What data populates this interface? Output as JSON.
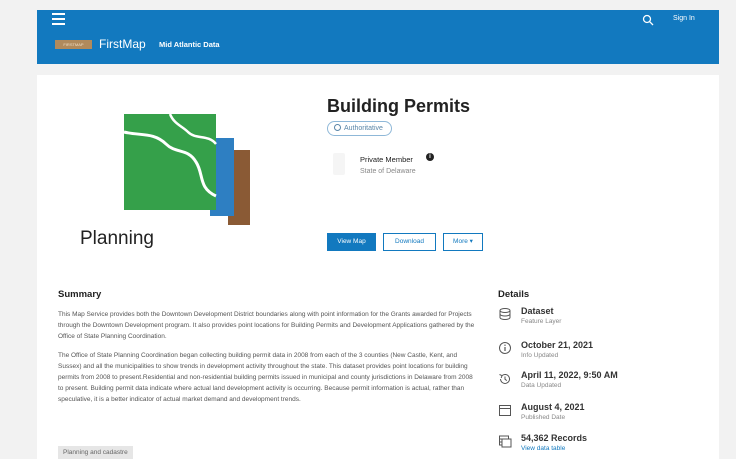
{
  "header": {
    "app_title": "FirstMap",
    "subtitle": "Mid Atlantic Data",
    "sign_in": "Sign In",
    "logo_text": "FIRSTMAP",
    "colors": {
      "bar": "#1279bf",
      "text": "#ffffff"
    }
  },
  "item": {
    "title": "Building Permits",
    "badge": "Authoritative",
    "thumbnail_caption": "Planning",
    "owner_name": "Private Member",
    "owner_org": "State of Delaware"
  },
  "actions": {
    "view_map": "View Map",
    "download": "Download",
    "more": "More ▾"
  },
  "summary": {
    "heading": "Summary",
    "paragraph1": "This Map Service provides both the Downtown Development District boundaries along with point information for the Grants awarded for Projects through the Downtown Development program. It also provides point locations for Building Permits and Development Applications gathered by the Office of State Planning Coordination.",
    "paragraph2": "The Office of State Planning Coordination began collecting building permit data in 2008 from each of the 3 counties (New Castle, Kent, and Sussex) and all the municipalities to show trends in development activity throughout the state. This dataset provides point locations for building permits from 2008 to present.Residential and non-residential building permits issued in municipal and county jurisdictions in Delaware from 2008 to present. Building permit data indicate where actual land development activity is occurring. Because permit information is actual, rather than speculative, it is a better indicator of actual market demand and development trends.",
    "tag": "Planning and cadastre"
  },
  "details": {
    "heading": "Details",
    "items": [
      {
        "value": "Dataset",
        "label": "Feature Layer"
      },
      {
        "value": "October 21, 2021",
        "label": "Info Updated"
      },
      {
        "value": "April 11, 2022, 9:50 AM",
        "label": "Data Updated"
      },
      {
        "value": "August 4, 2021",
        "label": "Published Date"
      },
      {
        "value": "54,362 Records",
        "label": "View data table"
      }
    ]
  }
}
